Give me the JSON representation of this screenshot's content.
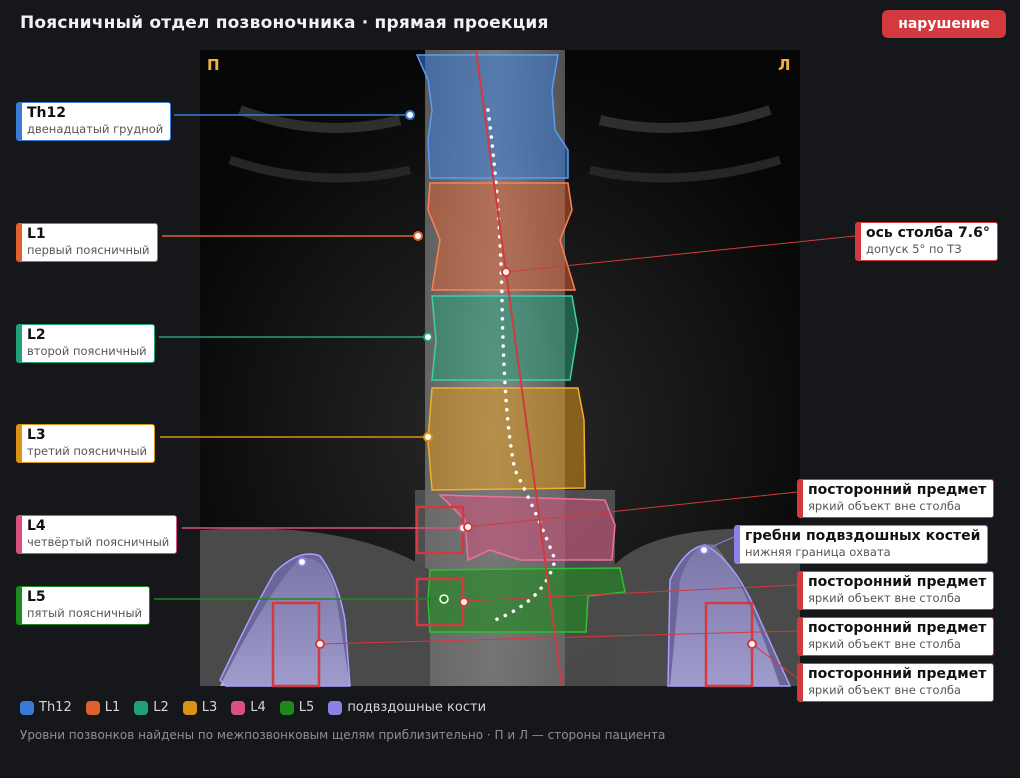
{
  "header": {
    "title": "Поясничный отдел позвоночника · прямая проекция",
    "status": "нарушение",
    "status_color": "#d23a3f"
  },
  "viewer": {
    "side_right": "П",
    "side_left": "Л"
  },
  "levels": [
    {
      "id": "th12",
      "name": "Th12",
      "desc": "двенадцатый грудной",
      "color": "#3a7bd5"
    },
    {
      "id": "l1",
      "name": "L1",
      "desc": "первый поясничный",
      "color": "#e0612f"
    },
    {
      "id": "l2",
      "name": "L2",
      "desc": "второй поясничный",
      "color": "#22a07a"
    },
    {
      "id": "l3",
      "name": "L3",
      "desc": "третий поясничный",
      "color": "#d99418"
    },
    {
      "id": "l4",
      "name": "L4",
      "desc": "четвёртый поясничный",
      "color": "#d9507e"
    },
    {
      "id": "l5",
      "name": "L5",
      "desc": "пятый поясничный",
      "color": "#1c8a1c"
    }
  ],
  "axis": {
    "title": "ось столба 7.6°",
    "sub": "допуск 5° по ТЗ",
    "color": "#d23a3f"
  },
  "iliac": {
    "title": "гребни подвздошных костей",
    "sub": "нижняя граница охвата",
    "color": "#8a82e6"
  },
  "foreign": [
    {
      "title": "посторонний предмет",
      "sub": "яркий объект вне столба"
    },
    {
      "title": "посторонний предмет",
      "sub": "яркий объект вне столба"
    },
    {
      "title": "посторонний предмет",
      "sub": "яркий объект вне столба"
    },
    {
      "title": "посторонний предмет",
      "sub": "яркий объект вне столба"
    }
  ],
  "legend": [
    {
      "label": "Th12",
      "color": "#3a7bd5"
    },
    {
      "label": "L1",
      "color": "#e0612f"
    },
    {
      "label": "L2",
      "color": "#22a07a"
    },
    {
      "label": "L3",
      "color": "#d99418"
    },
    {
      "label": "L4",
      "color": "#d9507e"
    },
    {
      "label": "L5",
      "color": "#1c8a1c"
    },
    {
      "label": "подвздошные кости",
      "color": "#8a82e6"
    }
  ],
  "footer": {
    "note": "Уровни позвонков найдены по межпозвонковым щелям приблизительно · П и Л — стороны пациента"
  }
}
